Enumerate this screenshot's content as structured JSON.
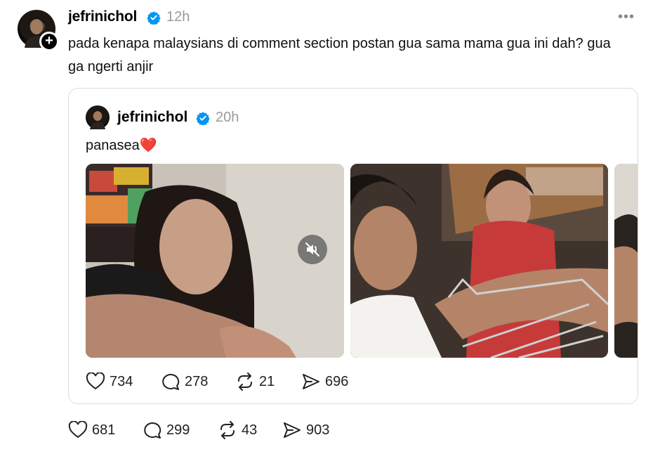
{
  "post": {
    "username": "jefrinichol",
    "time": "12h",
    "more_label": "•••",
    "text": "pada kenapa malaysians di comment section postan gua sama mama gua ini dah? gua ga ngerti anjir",
    "follow_badge": "+",
    "actions": {
      "likes": "681",
      "replies": "299",
      "reposts": "43",
      "shares": "903"
    }
  },
  "quote": {
    "username": "jefrinichol",
    "time": "20h",
    "text": "panasea",
    "emoji": "❤️",
    "actions": {
      "likes": "734",
      "replies": "278",
      "reposts": "21",
      "shares": "696"
    }
  },
  "colors": {
    "verified": "#0095f6",
    "secondary_text": "#9a9a9a",
    "border": "#dcdcdc"
  },
  "icons": [
    "verified-badge-icon",
    "more-icon",
    "heart-icon",
    "comment-icon",
    "repost-icon",
    "share-icon",
    "mute-icon"
  ]
}
